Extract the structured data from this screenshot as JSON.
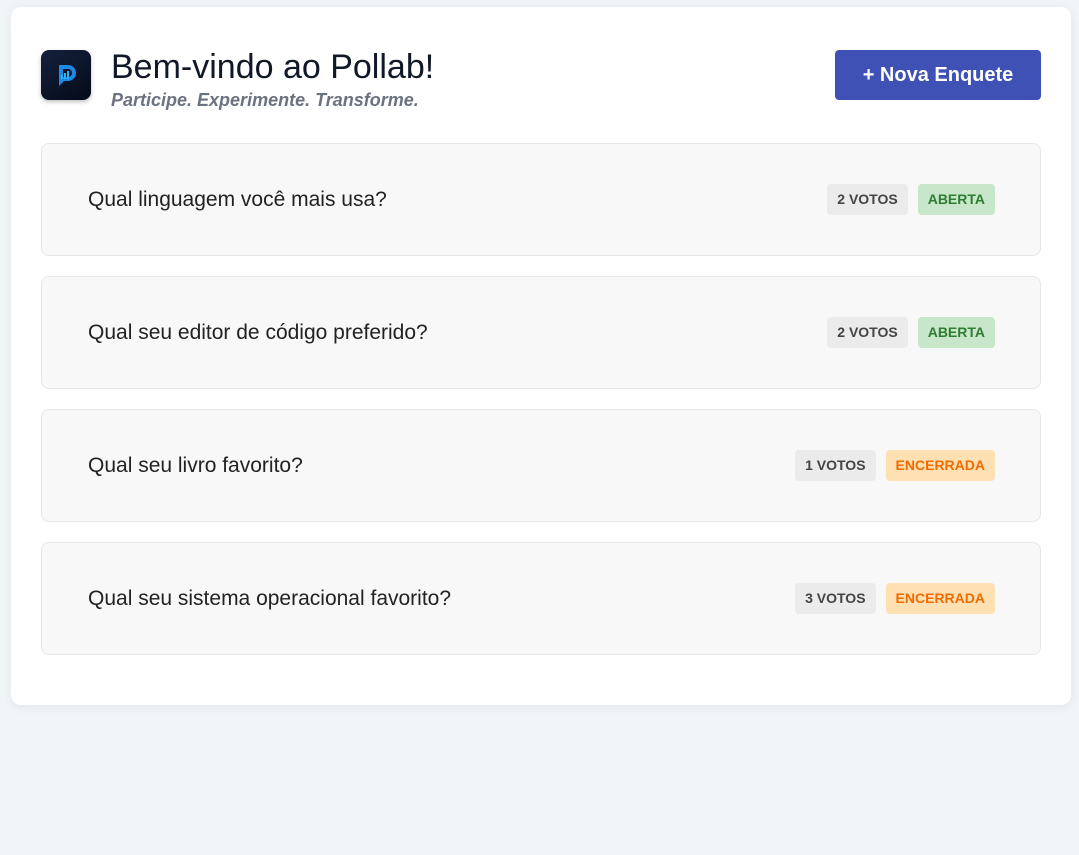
{
  "header": {
    "title": "Bem-vindo ao Pollab!",
    "subtitle": "Participe. Experimente. Transforme.",
    "new_poll_label": "+ Nova Enquete",
    "logo_icon": "pollab-logo-icon"
  },
  "polls": [
    {
      "question": "Qual linguagem você mais usa?",
      "votes": "2 votos",
      "status": "aberta",
      "state": "open"
    },
    {
      "question": "Qual seu editor de código preferido?",
      "votes": "2 votos",
      "status": "aberta",
      "state": "open"
    },
    {
      "question": "Qual seu livro favorito?",
      "votes": "1 votos",
      "status": "encerrada",
      "state": "closed"
    },
    {
      "question": "Qual seu sistema operacional favorito?",
      "votes": "3 votos",
      "status": "encerrada",
      "state": "closed"
    }
  ],
  "colors": {
    "primary": "#3f51b5",
    "open_bg": "#c8e6c9",
    "open_text": "#2e7d32",
    "closed_bg": "#ffe0b2",
    "closed_text": "#ef6c00",
    "page_bg": "#f2f5f8"
  }
}
